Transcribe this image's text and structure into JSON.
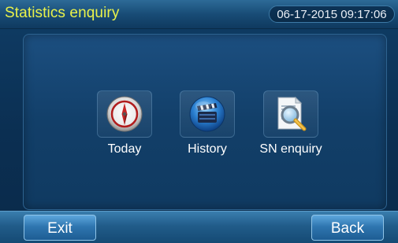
{
  "header": {
    "title": "Statistics enquiry",
    "datetime": "06-17-2015 09:17:06"
  },
  "menu": {
    "items": [
      {
        "label": "Today",
        "icon": "compass-icon"
      },
      {
        "label": "History",
        "icon": "film-clapper-icon"
      },
      {
        "label": "SN enquiry",
        "icon": "document-search-icon"
      }
    ]
  },
  "footer": {
    "exit_label": "Exit",
    "back_label": "Back"
  },
  "colors": {
    "title": "#e9f24a",
    "background": "#0f3d66",
    "button": "#2f76b0"
  }
}
